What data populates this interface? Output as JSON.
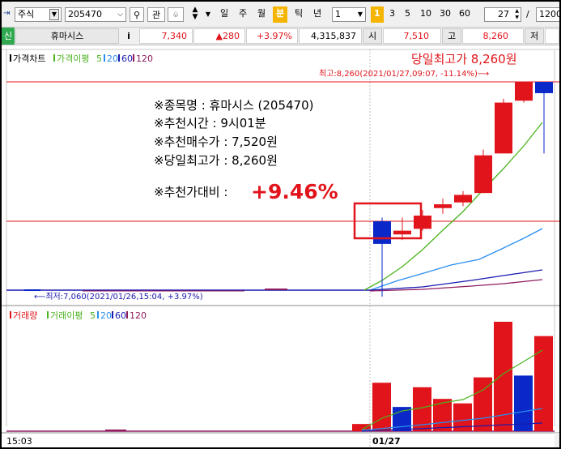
{
  "toolbar": {
    "market_select": "주식",
    "code_input": "205470",
    "btn_gwan": "관",
    "periods": [
      "일",
      "주",
      "월",
      "분",
      "틱",
      "년"
    ],
    "active_period": "분",
    "interval_value": "1",
    "intervals": [
      "1",
      "3",
      "5",
      "10",
      "30",
      "60"
    ],
    "active_interval": "1",
    "count_value": "27",
    "count_sep": "/",
    "count_total": "1200"
  },
  "quote": {
    "tag": "신",
    "name": "휴마시스",
    "info_icon": "i",
    "price": "7,340",
    "change": "▲280",
    "change_rate": "+3.97%",
    "volume": "4,315,837",
    "open_label": "시",
    "open_value": "7,510",
    "high_label": "고",
    "high_value": "8,260",
    "low_label": "저"
  },
  "price_legend": {
    "main": "가격차트",
    "ma_label": "가격이평",
    "ma_periods": [
      "5",
      "20",
      "60",
      "120"
    ]
  },
  "volume_legend": {
    "main": "거래량",
    "ma_label": "거래이평",
    "ma_periods": [
      "5",
      "20",
      "60",
      "120"
    ]
  },
  "annotations": {
    "headline": "당일최고가 8,260원",
    "high_marker": "최고:8,260(2021/01/27,09:07, -11.14%)⟶",
    "low_marker": "⟵최저:7,060(2021/01/26,15:04, +3.97%)",
    "note_lines": [
      "※종목명 : 휴마시스 (205470)",
      "※추천시간 : 9시01분",
      "※추천매수가 : 7,520원",
      "※당일최고가 : 8,260원"
    ],
    "gain_label": "※추천가대비 :",
    "gain_value": "+9.46%"
  },
  "xaxis": {
    "left_label": "15:03",
    "date_label": "01/27"
  },
  "colors": {
    "up": "#e0141a",
    "down": "#0a28c8",
    "ma5": "#4ab31e",
    "ma20": "#2a8ff0",
    "ma60": "#1a1ab0",
    "ma120": "#8e1a5e"
  },
  "chart_data": {
    "type": "candlestick",
    "candles": [
      {
        "time": "01/27 09:00",
        "open": 7520,
        "high": 7540,
        "low": 7120,
        "close": 7400
      },
      {
        "time": "01/27 09:01",
        "open": 7450,
        "high": 7540,
        "low": 7420,
        "close": 7470
      },
      {
        "time": "01/27 09:02",
        "open": 7480,
        "high": 7580,
        "low": 7470,
        "close": 7550
      },
      {
        "time": "01/27 09:03",
        "open": 7590,
        "high": 7640,
        "low": 7560,
        "close": 7610
      },
      {
        "time": "01/27 09:04",
        "open": 7620,
        "high": 7680,
        "low": 7600,
        "close": 7660
      },
      {
        "time": "01/27 09:05",
        "open": 7670,
        "high": 7900,
        "low": 7670,
        "close": 7870
      },
      {
        "time": "01/27 09:06",
        "open": 7880,
        "high": 8170,
        "low": 7880,
        "close": 8150
      },
      {
        "time": "01/27 09:07",
        "open": 8160,
        "high": 8260,
        "low": 8150,
        "close": 8260
      },
      {
        "time": "01/27 09:08",
        "open": 8260,
        "high": 8260,
        "low": 7880,
        "close": 8200
      }
    ],
    "volumes": [
      {
        "time": "01/27 09:00",
        "value": 8000,
        "up": true
      },
      {
        "time": "01/27 09:01",
        "value": 54000,
        "up": true
      },
      {
        "time": "01/27 09:02",
        "value": 27000,
        "up": false
      },
      {
        "time": "01/27 09:03",
        "value": 49000,
        "up": true
      },
      {
        "time": "01/27 09:04",
        "value": 36000,
        "up": true
      },
      {
        "time": "01/27 09:05",
        "value": 31000,
        "up": true
      },
      {
        "time": "01/27 09:06",
        "value": 60000,
        "up": true
      },
      {
        "time": "01/27 09:07",
        "value": 122000,
        "up": true
      },
      {
        "time": "01/27 09:08",
        "value": 62000,
        "up": false
      },
      {
        "time": "01/27 09:09",
        "value": 106000,
        "up": true
      }
    ],
    "high_price": 8260,
    "low_price": 7060,
    "recommend_price": 7520
  }
}
